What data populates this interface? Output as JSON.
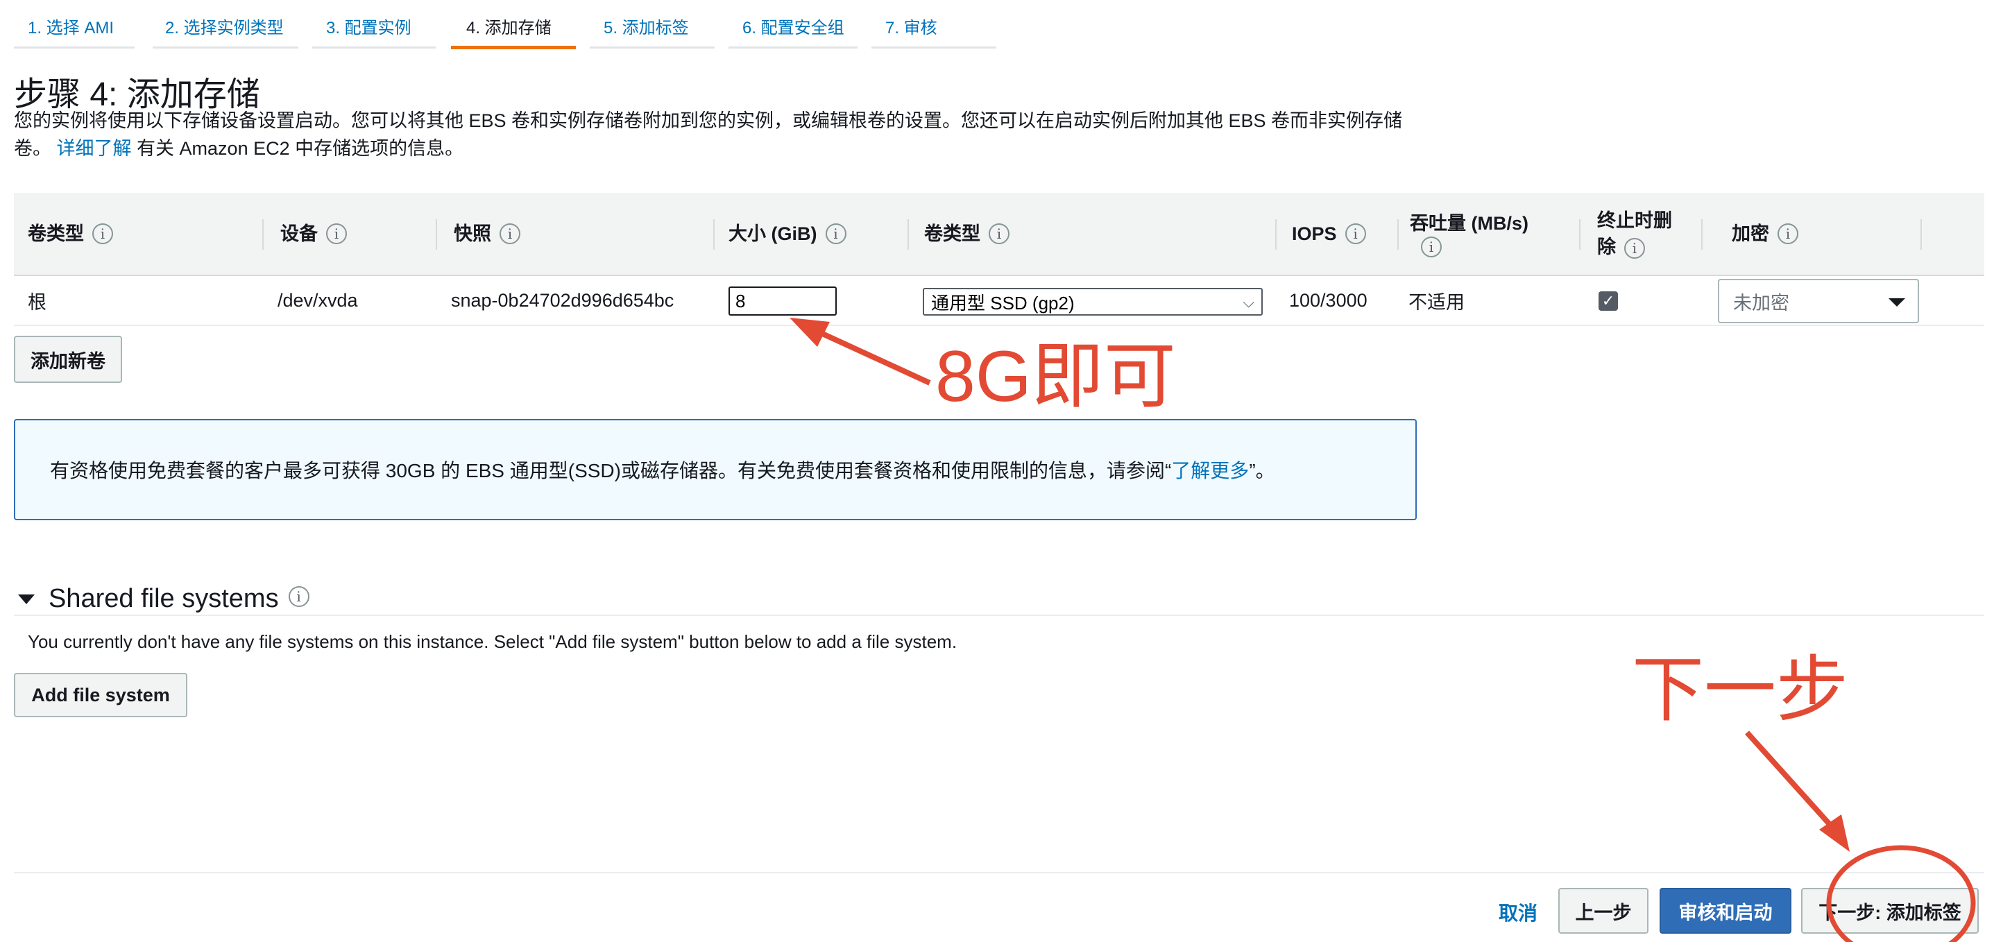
{
  "tabs": [
    {
      "label": "1. 选择 AMI",
      "active": false
    },
    {
      "label": "2. 选择实例类型",
      "active": false
    },
    {
      "label": "3. 配置实例",
      "active": false
    },
    {
      "label": "4. 添加存储",
      "active": true
    },
    {
      "label": "5. 添加标签",
      "active": false
    },
    {
      "label": "6. 配置安全组",
      "active": false
    },
    {
      "label": "7. 审核",
      "active": false
    }
  ],
  "page": {
    "title": "步骤 4: 添加存储",
    "description_part1": "您的实例将使用以下存储设备设置启动。您可以将其他 EBS 卷和实例存储卷附加到您的实例，或编辑根卷的设置。您还可以在启动实例后附加其他 EBS 卷而非实例存储卷。",
    "description_link": "详细了解",
    "description_part2": "有关 Amazon EC2 中存储选项的信息。"
  },
  "table": {
    "headers": {
      "volume_type": "卷类型",
      "device": "设备",
      "snapshot": "快照",
      "size": "大小 (GiB)",
      "volume_kind": "卷类型",
      "iops": "IOPS",
      "throughput_line1": "吞吐量 (MB/s)",
      "delete_line1": "终止时删",
      "delete_line2": "除",
      "encryption": "加密"
    },
    "row": {
      "volume_type": "根",
      "device": "/dev/xvda",
      "snapshot": "snap-0b24702d996d654bc",
      "size": "8",
      "volume_kind": "通用型 SSD (gp2)",
      "iops": "100/3000",
      "throughput": "不适用",
      "delete_on_termination": true,
      "encryption": "未加密"
    }
  },
  "buttons": {
    "add_volume": "添加新卷",
    "add_file_system": "Add file system",
    "cancel": "取消",
    "previous": "上一步",
    "review_launch": "审核和启动",
    "next": "下一步: 添加标签"
  },
  "info_box": {
    "text": "有资格使用免费套餐的客户最多可获得 30GB 的 EBS 通用型(SSD)或磁存储器。有关免费使用套餐资格和使用限制的信息，请参阅“",
    "link": "了解更多",
    "suffix": "”。"
  },
  "shared_fs": {
    "title": "Shared file systems",
    "message": "You currently don't have any file systems on this instance. Select \"Add file system\" button below to add a file system."
  },
  "annotations": {
    "size_note": "8G即可",
    "next_note": "下一步",
    "color": "#e24a33"
  },
  "icons": {
    "info": "i",
    "checkmark": "✓",
    "chevron": "⌵"
  }
}
